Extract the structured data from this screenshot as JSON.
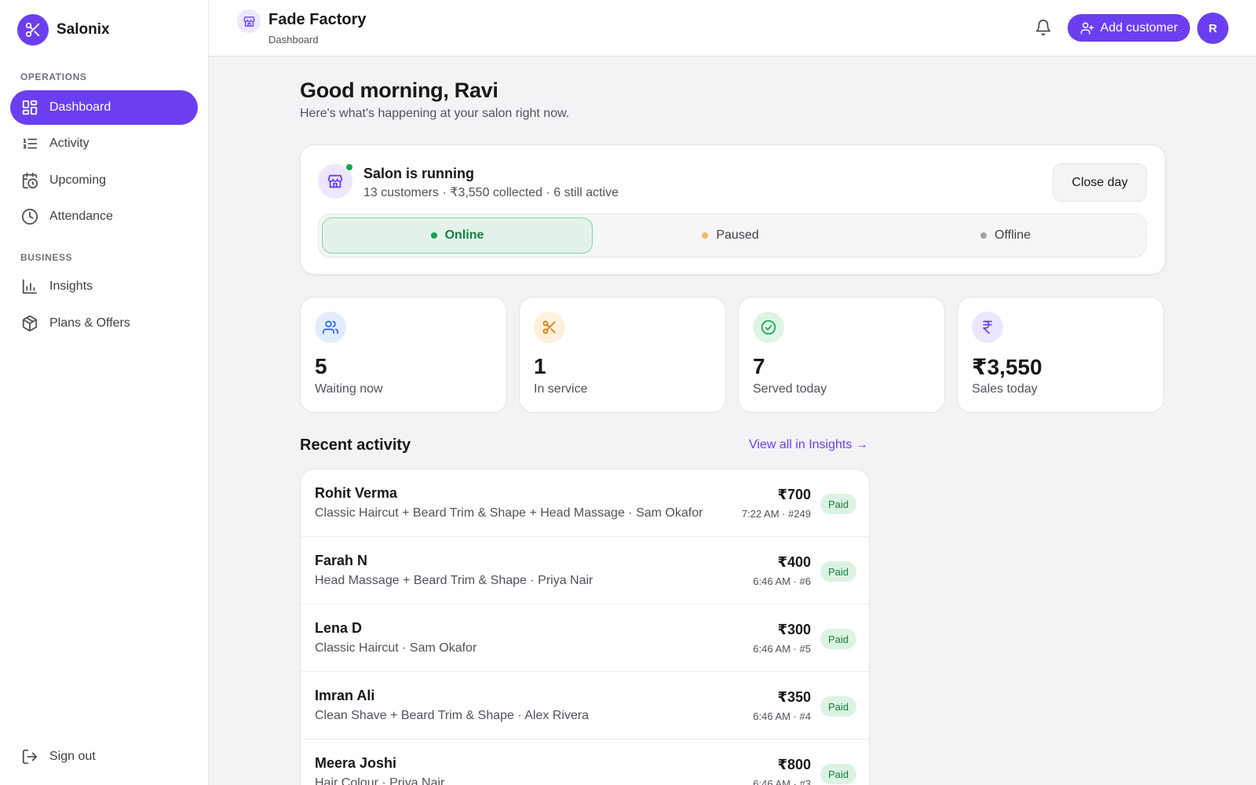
{
  "app": {
    "brand": "Salonix"
  },
  "sidebar": {
    "sections": [
      {
        "label": "OPERATIONS"
      },
      {
        "label": "BUSINESS"
      }
    ],
    "items": [
      {
        "label": "Dashboard",
        "active": true
      },
      {
        "label": "Activity"
      },
      {
        "label": "Upcoming"
      },
      {
        "label": "Attendance"
      },
      {
        "label": "Insights"
      },
      {
        "label": "Plans & Offers"
      }
    ],
    "sign_out": "Sign out"
  },
  "header": {
    "shop_name": "Fade Factory",
    "breadcrumb": "Dashboard",
    "add_customer": "Add customer",
    "avatar_initial": "R"
  },
  "main": {
    "greeting": "Good morning, Ravi",
    "greeting_sub": "Here's what's happening at your salon right now.",
    "status": {
      "title": "Salon is running",
      "summary": "13 customers · ₹3,550 collected · 6 still active",
      "close_day": "Close day",
      "modes": [
        {
          "label": "Online",
          "selected": true,
          "color": "#16a34a"
        },
        {
          "label": "Paused",
          "color": "#f2b866"
        },
        {
          "label": "Offline",
          "color": "#a1a1aa"
        }
      ]
    },
    "stats": [
      {
        "value": "5",
        "label": "Waiting now",
        "icon": "users-icon",
        "color": "#2563eb",
        "bg": "#e3ecfd"
      },
      {
        "value": "1",
        "label": "In service",
        "icon": "scissors-icon",
        "color": "#d97706",
        "bg": "#fdf0dc"
      },
      {
        "value": "7",
        "label": "Served today",
        "icon": "check-circle-icon",
        "color": "#16a34a",
        "bg": "#def4e6"
      },
      {
        "value": "₹3,550",
        "label": "Sales today",
        "icon": "rupee-icon",
        "color": "#6b3ff0",
        "bg": "#ece7fd"
      }
    ],
    "recent": {
      "title": "Recent activity",
      "view_all": "View all in Insights →",
      "rows": [
        {
          "name": "Rohit Verma",
          "desc": "Classic Haircut + Beard Trim & Shape + Head Massage · Sam Okafor",
          "amount": "₹700",
          "meta": "7:22 AM · #249",
          "badge": "Paid"
        },
        {
          "name": "Farah N",
          "desc": "Head Massage + Beard Trim & Shape · Priya Nair",
          "amount": "₹400",
          "meta": "6:46 AM · #6",
          "badge": "Paid"
        },
        {
          "name": "Lena D",
          "desc": "Classic Haircut · Sam Okafor",
          "amount": "₹300",
          "meta": "6:46 AM · #5",
          "badge": "Paid"
        },
        {
          "name": "Imran Ali",
          "desc": "Clean Shave + Beard Trim & Shape · Alex Rivera",
          "amount": "₹350",
          "meta": "6:46 AM · #4",
          "badge": "Paid"
        },
        {
          "name": "Meera Joshi",
          "desc": "Hair Colour · Priya Nair",
          "amount": "₹800",
          "meta": "6:46 AM · #3",
          "badge": "Paid"
        }
      ]
    }
  },
  "colors": {
    "accent": "#6b3ff0",
    "success": "#16a34a"
  }
}
